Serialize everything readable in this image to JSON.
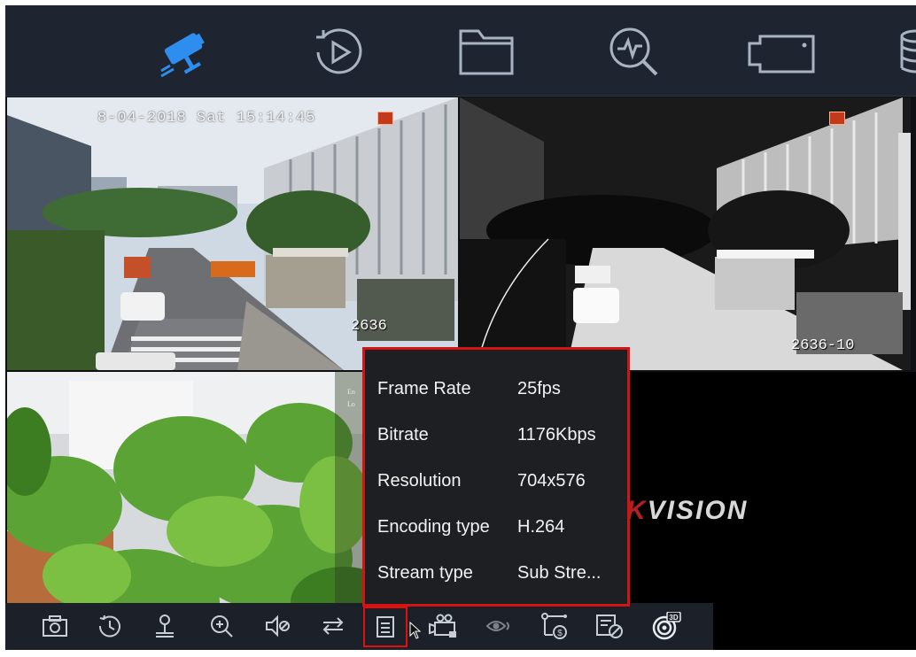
{
  "nav": {
    "items": [
      {
        "name": "live-view",
        "icon": "camera-icon",
        "active": true
      },
      {
        "name": "playback",
        "icon": "playback-icon",
        "active": false
      },
      {
        "name": "files",
        "icon": "folder-icon",
        "active": false
      },
      {
        "name": "smart-search",
        "icon": "search-analytics-icon",
        "active": false
      },
      {
        "name": "camera-management",
        "icon": "video-camera-icon",
        "active": false
      },
      {
        "name": "storage",
        "icon": "database-icon",
        "active": false
      }
    ],
    "active_color": "#2e8ef0"
  },
  "channels": {
    "ch1": {
      "timestamp": "8-04-2018 Sat 15:14:45",
      "name": "2636"
    },
    "ch2": {
      "name": "2636-10"
    },
    "ch3": {
      "side_text": "En\nLo"
    },
    "ch4": {
      "logo_prefix": "K",
      "logo_text": "VISION"
    }
  },
  "info_popup": {
    "rows": [
      {
        "label": "Frame Rate",
        "value": "25fps"
      },
      {
        "label": "Bitrate",
        "value": "1176Kbps"
      },
      {
        "label": "Resolution",
        "value": "704x576"
      },
      {
        "label": "Encoding type",
        "value": "H.264"
      },
      {
        "label": "Stream type",
        "value": "Sub Stre..."
      }
    ],
    "border_color": "#d21414"
  },
  "toolbar": {
    "buttons": [
      {
        "name": "capture",
        "icon": "snapshot-icon"
      },
      {
        "name": "instant-playback",
        "icon": "instant-playback-icon"
      },
      {
        "name": "ptz",
        "icon": "ptz-icon"
      },
      {
        "name": "digital-zoom",
        "icon": "zoom-in-icon"
      },
      {
        "name": "audio",
        "icon": "mute-icon"
      },
      {
        "name": "switch-stream",
        "icon": "switch-icon"
      },
      {
        "name": "information",
        "icon": "info-list-icon"
      },
      {
        "name": "record",
        "icon": "camera-record-icon"
      },
      {
        "name": "thermal",
        "icon": "eye-icon"
      },
      {
        "name": "route-status",
        "icon": "route-icon"
      },
      {
        "name": "disable",
        "icon": "disable-icon"
      },
      {
        "name": "3d-positioning",
        "icon": "3d-icon",
        "badge": "3D"
      }
    ]
  }
}
